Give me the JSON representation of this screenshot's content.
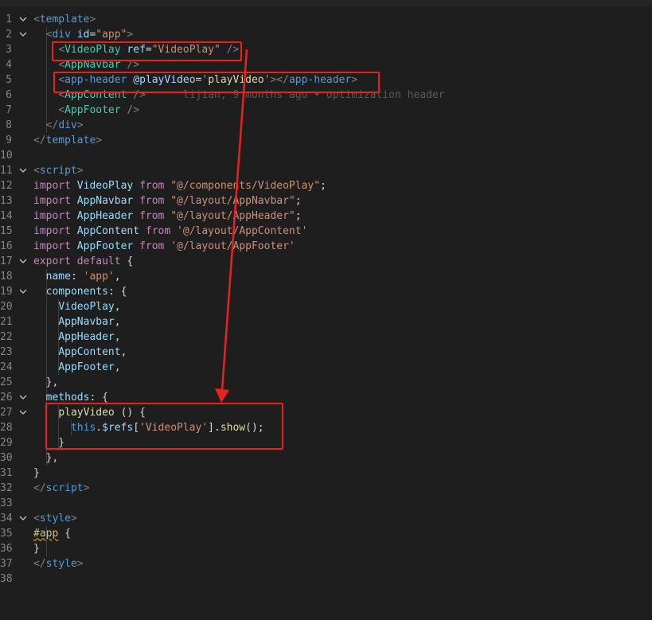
{
  "colors": {
    "background": "#1e1e1e",
    "annotation": "#e8221e",
    "line_number": "#858585"
  },
  "blame": {
    "text": "lijian, 9 months ago • optimization header"
  },
  "lines": [
    {
      "n": "1",
      "fold": true,
      "tokens": [
        [
          "t-punc",
          "<"
        ],
        [
          "t-tag",
          "template"
        ],
        [
          "t-punc",
          ">"
        ]
      ]
    },
    {
      "n": "2",
      "fold": true,
      "tokens": [
        [
          "t-plain",
          "  "
        ],
        [
          "t-punc",
          "<"
        ],
        [
          "t-tag",
          "div"
        ],
        [
          "t-plain",
          " "
        ],
        [
          "t-attr",
          "id"
        ],
        [
          "t-plain",
          "="
        ],
        [
          "t-str",
          "\"app\""
        ],
        [
          "t-punc",
          ">"
        ]
      ]
    },
    {
      "n": "3",
      "tokens": [
        [
          "t-plain",
          "    "
        ],
        [
          "t-punc",
          "<"
        ],
        [
          "t-comp",
          "VideoPlay"
        ],
        [
          "t-plain",
          " "
        ],
        [
          "t-attr",
          "ref"
        ],
        [
          "t-plain",
          "="
        ],
        [
          "t-str",
          "\"VideoPlay\""
        ],
        [
          "t-plain",
          " "
        ],
        [
          "t-punc",
          "/>"
        ]
      ]
    },
    {
      "n": "4",
      "tokens": [
        [
          "t-plain",
          "    "
        ],
        [
          "t-punc",
          "<"
        ],
        [
          "t-comp",
          "AppNavbar"
        ],
        [
          "t-plain",
          " "
        ],
        [
          "t-punc",
          "/>"
        ]
      ]
    },
    {
      "n": "5",
      "tokens": [
        [
          "t-plain",
          "    "
        ],
        [
          "t-punc",
          "<"
        ],
        [
          "t-tag",
          "app-header"
        ],
        [
          "t-plain",
          " "
        ],
        [
          "t-attr",
          "@playVideo"
        ],
        [
          "t-plain",
          "="
        ],
        [
          "t-str",
          "'"
        ],
        [
          "t-fn",
          "playVideo"
        ],
        [
          "t-str",
          "'"
        ],
        [
          "t-punc",
          "></"
        ],
        [
          "t-tag",
          "app-header"
        ],
        [
          "t-punc",
          ">"
        ]
      ]
    },
    {
      "n": "6",
      "blame": true,
      "tokens": [
        [
          "t-plain",
          "    "
        ],
        [
          "t-punc",
          "<"
        ],
        [
          "t-comp",
          "AppContent"
        ],
        [
          "t-plain",
          " "
        ],
        [
          "t-punc",
          "/>"
        ]
      ]
    },
    {
      "n": "7",
      "tokens": [
        [
          "t-plain",
          "    "
        ],
        [
          "t-punc",
          "<"
        ],
        [
          "t-comp",
          "AppFooter"
        ],
        [
          "t-plain",
          " "
        ],
        [
          "t-punc",
          "/>"
        ]
      ]
    },
    {
      "n": "8",
      "tokens": [
        [
          "t-plain",
          "  "
        ],
        [
          "t-punc",
          "</"
        ],
        [
          "t-tag",
          "div"
        ],
        [
          "t-punc",
          ">"
        ]
      ]
    },
    {
      "n": "9",
      "tokens": [
        [
          "t-punc",
          "</"
        ],
        [
          "t-tag",
          "template"
        ],
        [
          "t-punc",
          ">"
        ]
      ]
    },
    {
      "n": "10",
      "tokens": []
    },
    {
      "n": "11",
      "fold": true,
      "tokens": [
        [
          "t-punc",
          "<"
        ],
        [
          "t-tag",
          "script"
        ],
        [
          "t-punc",
          ">"
        ]
      ]
    },
    {
      "n": "12",
      "tokens": [
        [
          "t-kw",
          "import"
        ],
        [
          "t-plain",
          " "
        ],
        [
          "t-var",
          "VideoPlay"
        ],
        [
          "t-plain",
          " "
        ],
        [
          "t-kw",
          "from"
        ],
        [
          "t-plain",
          " "
        ],
        [
          "t-str",
          "\"@/components/VideoPlay\""
        ],
        [
          "t-plain",
          ";"
        ]
      ]
    },
    {
      "n": "13",
      "tokens": [
        [
          "t-kw",
          "import"
        ],
        [
          "t-plain",
          " "
        ],
        [
          "t-var",
          "AppNavbar"
        ],
        [
          "t-plain",
          " "
        ],
        [
          "t-kw",
          "from"
        ],
        [
          "t-plain",
          " "
        ],
        [
          "t-str",
          "\"@/layout/AppNavbar\""
        ],
        [
          "t-plain",
          ";"
        ]
      ]
    },
    {
      "n": "14",
      "tokens": [
        [
          "t-kw",
          "import"
        ],
        [
          "t-plain",
          " "
        ],
        [
          "t-var",
          "AppHeader"
        ],
        [
          "t-plain",
          " "
        ],
        [
          "t-kw",
          "from"
        ],
        [
          "t-plain",
          " "
        ],
        [
          "t-str",
          "\"@/layout/AppHeader\""
        ],
        [
          "t-plain",
          ";"
        ]
      ]
    },
    {
      "n": "15",
      "tokens": [
        [
          "t-kw",
          "import"
        ],
        [
          "t-plain",
          " "
        ],
        [
          "t-var",
          "AppContent"
        ],
        [
          "t-plain",
          " "
        ],
        [
          "t-kw",
          "from"
        ],
        [
          "t-plain",
          " "
        ],
        [
          "t-str",
          "'@/layout/AppContent'"
        ]
      ]
    },
    {
      "n": "16",
      "tokens": [
        [
          "t-kw",
          "import"
        ],
        [
          "t-plain",
          " "
        ],
        [
          "t-var",
          "AppFooter"
        ],
        [
          "t-plain",
          " "
        ],
        [
          "t-kw",
          "from"
        ],
        [
          "t-plain",
          " "
        ],
        [
          "t-str",
          "'@/layout/AppFooter'"
        ]
      ]
    },
    {
      "n": "17",
      "fold": true,
      "tokens": [
        [
          "t-kw",
          "export"
        ],
        [
          "t-plain",
          " "
        ],
        [
          "t-kw",
          "default"
        ],
        [
          "t-plain",
          " {"
        ]
      ]
    },
    {
      "n": "18",
      "tokens": [
        [
          "t-plain",
          "  "
        ],
        [
          "t-var",
          "name"
        ],
        [
          "t-plain",
          ": "
        ],
        [
          "t-str",
          "'app'"
        ],
        [
          "t-plain",
          ","
        ]
      ]
    },
    {
      "n": "19",
      "fold": true,
      "tokens": [
        [
          "t-plain",
          "  "
        ],
        [
          "t-var",
          "components"
        ],
        [
          "t-plain",
          ": {"
        ]
      ]
    },
    {
      "n": "20",
      "tokens": [
        [
          "t-plain",
          "    "
        ],
        [
          "t-var",
          "VideoPlay"
        ],
        [
          "t-plain",
          ","
        ]
      ]
    },
    {
      "n": "21",
      "tokens": [
        [
          "t-plain",
          "    "
        ],
        [
          "t-var",
          "AppNavbar"
        ],
        [
          "t-plain",
          ","
        ]
      ]
    },
    {
      "n": "22",
      "tokens": [
        [
          "t-plain",
          "    "
        ],
        [
          "t-var",
          "AppHeader"
        ],
        [
          "t-plain",
          ","
        ]
      ]
    },
    {
      "n": "23",
      "tokens": [
        [
          "t-plain",
          "    "
        ],
        [
          "t-var",
          "AppContent"
        ],
        [
          "t-plain",
          ","
        ]
      ]
    },
    {
      "n": "24",
      "tokens": [
        [
          "t-plain",
          "    "
        ],
        [
          "t-var",
          "AppFooter"
        ],
        [
          "t-plain",
          ","
        ]
      ]
    },
    {
      "n": "25",
      "tokens": [
        [
          "t-plain",
          "  },"
        ]
      ]
    },
    {
      "n": "26",
      "fold": true,
      "tokens": [
        [
          "t-plain",
          "  "
        ],
        [
          "t-var",
          "methods"
        ],
        [
          "t-plain",
          ": {"
        ]
      ]
    },
    {
      "n": "27",
      "fold": true,
      "tokens": [
        [
          "t-plain",
          "    "
        ],
        [
          "t-fn",
          "playVideo"
        ],
        [
          "t-plain",
          " () {"
        ]
      ]
    },
    {
      "n": "28",
      "tokens": [
        [
          "t-plain",
          "      "
        ],
        [
          "t-blue",
          "this"
        ],
        [
          "t-plain",
          "."
        ],
        [
          "t-var",
          "$refs"
        ],
        [
          "t-plain",
          "["
        ],
        [
          "t-str",
          "'VideoPlay'"
        ],
        [
          "t-plain",
          "]."
        ],
        [
          "t-fn",
          "show"
        ],
        [
          "t-plain",
          "();"
        ]
      ]
    },
    {
      "n": "29",
      "tokens": [
        [
          "t-plain",
          "    }"
        ]
      ]
    },
    {
      "n": "30",
      "tokens": [
        [
          "t-plain",
          "  },"
        ]
      ]
    },
    {
      "n": "31",
      "tokens": [
        [
          "t-plain",
          "}"
        ]
      ]
    },
    {
      "n": "32",
      "tokens": [
        [
          "t-punc",
          "</"
        ],
        [
          "t-tag",
          "script"
        ],
        [
          "t-punc",
          ">"
        ]
      ]
    },
    {
      "n": "33",
      "tokens": []
    },
    {
      "n": "34",
      "fold": true,
      "tokens": [
        [
          "t-punc",
          "<"
        ],
        [
          "t-tag",
          "style"
        ],
        [
          "t-punc",
          ">"
        ]
      ]
    },
    {
      "n": "35",
      "tokens": [
        [
          "t-sel",
          "#app"
        ],
        [
          "t-plain",
          " {"
        ]
      ]
    },
    {
      "n": "36",
      "tokens": [
        [
          "t-plain",
          "}"
        ]
      ]
    },
    {
      "n": "37",
      "tokens": [
        [
          "t-punc",
          "</"
        ],
        [
          "t-tag",
          "style"
        ],
        [
          "t-punc",
          ">"
        ]
      ]
    },
    {
      "n": "38",
      "tokens": []
    }
  ]
}
